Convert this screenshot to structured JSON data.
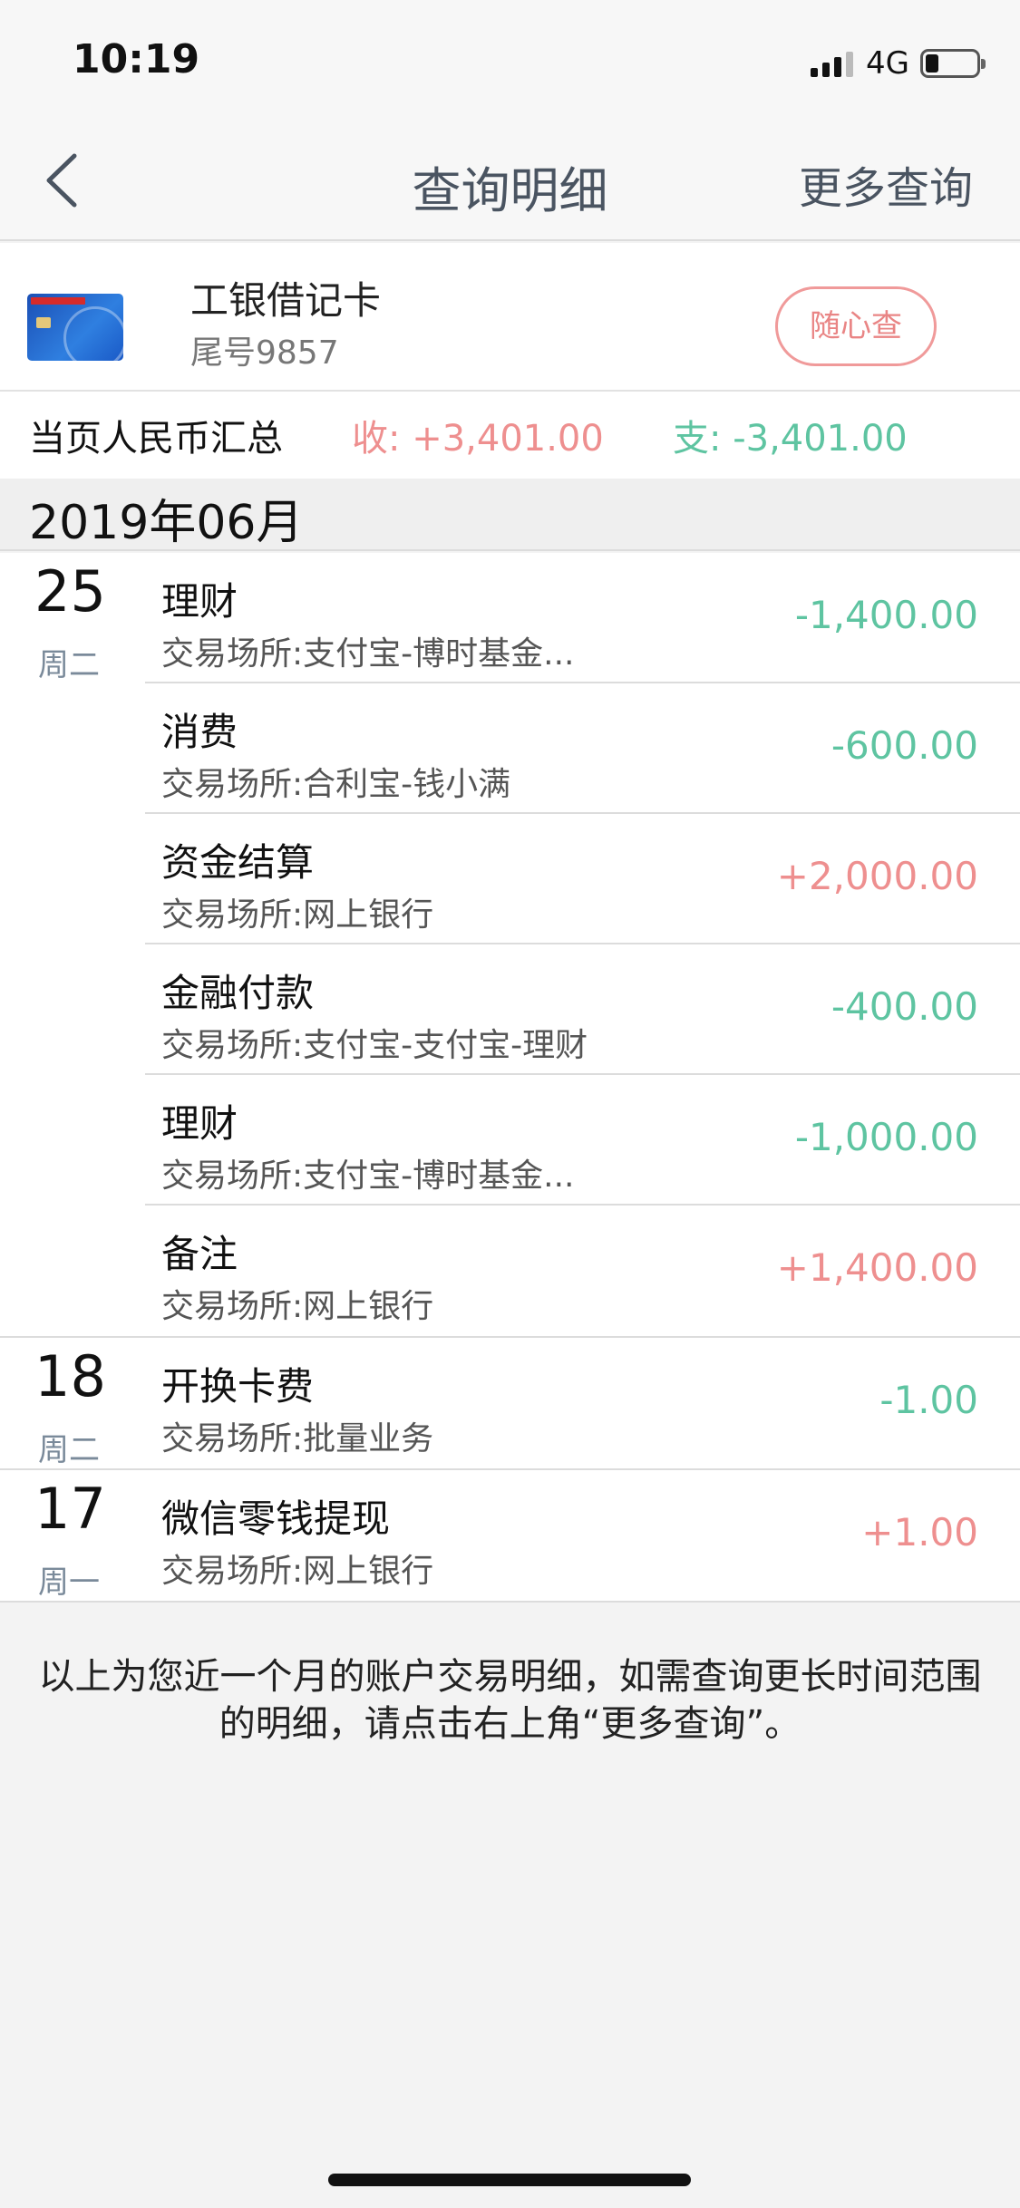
{
  "status_bar": {
    "time": "10:19",
    "network": "4G",
    "icons": [
      "signal-icon",
      "battery-icon"
    ]
  },
  "nav": {
    "back_icon": "chevron-left-icon",
    "title": "查询明细",
    "more_label": "更多查询"
  },
  "card": {
    "name": "工银借记卡",
    "tail": "尾号9857",
    "quick_query_label": "随心查"
  },
  "summary": {
    "label": "当页人民币汇总",
    "income": "收: +3,401.00",
    "expense": "支: -3,401.00"
  },
  "month": "2019年06月",
  "days": [
    {
      "day": "25",
      "weekday": "周二",
      "transactions": [
        {
          "title": "理财",
          "place": "交易场所:支付宝-博时基金...",
          "amount": "-1,400.00",
          "sign": "neg"
        },
        {
          "title": "消费",
          "place": "交易场所:合利宝-钱小满",
          "amount": "-600.00",
          "sign": "neg"
        },
        {
          "title": "资金结算",
          "place": "交易场所:网上银行",
          "amount": "+2,000.00",
          "sign": "pos"
        },
        {
          "title": "金融付款",
          "place": "交易场所:支付宝-支付宝-理财",
          "amount": "-400.00",
          "sign": "neg"
        },
        {
          "title": "理财",
          "place": "交易场所:支付宝-博时基金...",
          "amount": "-1,000.00",
          "sign": "neg"
        },
        {
          "title": "备注",
          "place": "交易场所:网上银行",
          "amount": "+1,400.00",
          "sign": "pos"
        }
      ]
    },
    {
      "day": "18",
      "weekday": "周二",
      "transactions": [
        {
          "title": "开换卡费",
          "place": "交易场所:批量业务",
          "amount": "-1.00",
          "sign": "neg"
        }
      ]
    },
    {
      "day": "17",
      "weekday": "周一",
      "transactions": [
        {
          "title": " 微信零钱提现",
          "place": "交易场所:网上银行",
          "amount": "+1.00",
          "sign": "pos"
        }
      ]
    }
  ],
  "footer_note": "以上为您近一个月的账户交易明细，如需查询更长时间范围的明细，请点击右上角“更多查询”。",
  "colors": {
    "income": "#ee8f8f",
    "expense": "#5ec4a1",
    "nav_text": "#4a5461"
  }
}
